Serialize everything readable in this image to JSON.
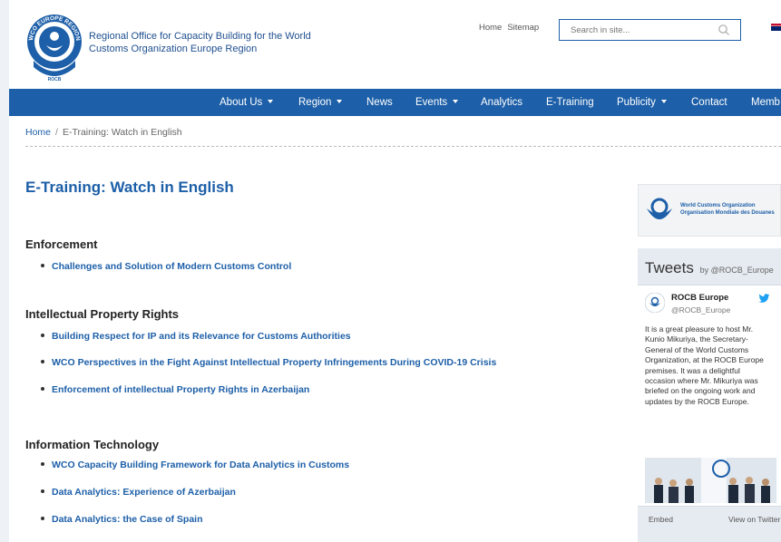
{
  "header": {
    "org_line1": "Regional Office for Capacity Building for the World",
    "org_line2": "Customs Organization Europe Region",
    "logo_text": "WCO EUROPE REGION",
    "logo_sub": "ROCB",
    "top_links": [
      "Home",
      "Sitemap"
    ],
    "search_placeholder": "Search in site..."
  },
  "nav": [
    {
      "label": "About Us",
      "dropdown": true
    },
    {
      "label": "Region",
      "dropdown": true
    },
    {
      "label": "News",
      "dropdown": false
    },
    {
      "label": "Events",
      "dropdown": true
    },
    {
      "label": "Analytics",
      "dropdown": false
    },
    {
      "label": "E-Training",
      "dropdown": false
    },
    {
      "label": "Publicity",
      "dropdown": true
    },
    {
      "label": "Contact",
      "dropdown": false
    },
    {
      "label": "Memb",
      "dropdown": false
    }
  ],
  "breadcrumb": {
    "home": "Home",
    "separator": "/",
    "current": "E-Training: Watch in English"
  },
  "page_title": "E-Training: Watch in English",
  "sections": [
    {
      "heading": "Enforcement",
      "links": [
        "Challenges and Solution of Modern Customs Control"
      ]
    },
    {
      "heading": "Intellectual Property Rights",
      "links": [
        "Building Respect for IP and its Relevance for Customs Authorities",
        "WCO Perspectives in the Fight Against Intellectual Property Infringements During COVID-19 Crisis",
        "Enforcement of intellectual Property Rights in Azerbaijan"
      ]
    },
    {
      "heading": "Information Technology",
      "links": [
        "WCO Capacity Building Framework for Data Analytics in Customs",
        "Data Analytics: Experience of Azerbaijan",
        "Data Analytics: the Case of Spain"
      ]
    }
  ],
  "sidebar": {
    "wco_line1": "World Customs Organization",
    "wco_line2": "Organisation Mondiale des Douanes",
    "tweets_title": "Tweets",
    "tweets_by": "by @ROCB_Europe",
    "tweet_author": "ROCB Europe",
    "tweet_handle": "@ROCB_Europe",
    "tweet_text": "It is a great pleasure to host Mr. Kunio Mikuriya, the Secretary-General of the World Customs Organization, at the ROCB Europe premises. It was a delightful occasion where Mr. Mikuriya was briefed on the ongoing work and updates by the ROCB Europe.",
    "embed": "Embed",
    "view_on": "View on Twitter"
  },
  "colors": {
    "primary": "#1d5fa8",
    "nav_bg": "#1d5fa8",
    "sidebar_bg": "#e6ebf1"
  }
}
